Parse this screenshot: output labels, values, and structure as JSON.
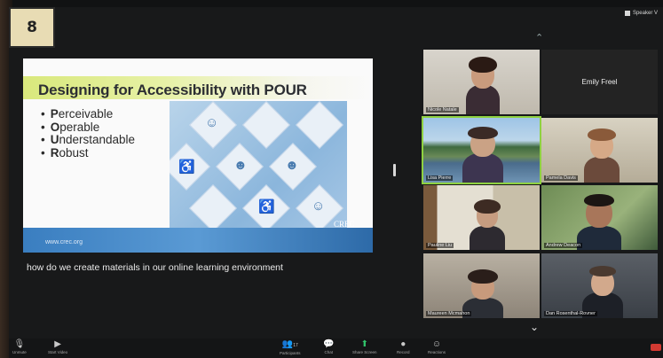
{
  "badge": "8",
  "top_right": {
    "view_label": "Speaker V",
    "up_icon": "chevron-up-icon"
  },
  "slide": {
    "title": "Designing for Accessibility with POUR",
    "bullets": [
      {
        "first": "P",
        "rest": "erceivable"
      },
      {
        "first": "O",
        "rest": "perable"
      },
      {
        "first": "U",
        "rest": "nderstandable"
      },
      {
        "first": "R",
        "rest": "obust"
      }
    ],
    "url": "www.crec.org",
    "logo_text": "CREC"
  },
  "caption": "how do we create materials in our online learning environment",
  "participants": [
    {
      "name": "Nicole Natale"
    },
    {
      "name": "Emily Freel"
    },
    {
      "name": "Lisa Pierre"
    },
    {
      "name": "Pamela Davis"
    },
    {
      "name": "Pauline Liu"
    },
    {
      "name": "Andrew Deacon"
    },
    {
      "name": "Maureen Mcmahon"
    },
    {
      "name": "Dan Rosenthal-Rovner"
    }
  ],
  "toolbar": {
    "unmute": "Unmute",
    "start_video": "Start Video",
    "participants": "Participants",
    "participants_count": "17",
    "chat": "Chat",
    "share_screen": "Share Screen",
    "record": "Record",
    "reactions": "Reactions"
  },
  "colors": {
    "active_speaker": "#8fd141",
    "share_green": "#31c46b",
    "end_red": "#d23a32"
  }
}
